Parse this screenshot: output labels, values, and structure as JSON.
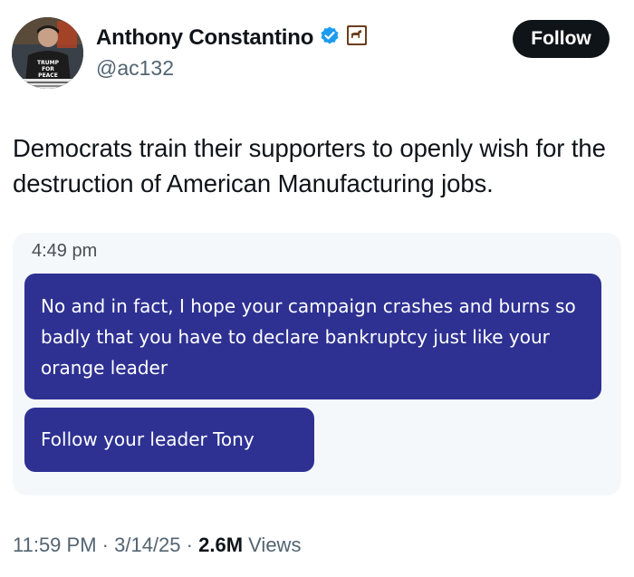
{
  "author": {
    "display_name": "Anthony Constantino",
    "handle": "@ac132",
    "avatar_shirt_text": "TRUMP FOR PEACE",
    "verified_icon": "verified-badge-icon",
    "affiliate_icon": "affiliate-badge-icon",
    "colors": {
      "verified": "#1d9bf0",
      "affiliate": "#6b3e1f"
    }
  },
  "follow_button": {
    "label": "Follow"
  },
  "tweet": {
    "text": "Democrats train their supporters to openly wish for the destruction of American Manufacturing jobs."
  },
  "media": {
    "timestamp": "4:49 pm",
    "messages": [
      {
        "text": "No and in fact, I hope your campaign crashes and burns so badly that you have to declare bankruptcy just like your orange leader"
      },
      {
        "text": "Follow your leader Tony"
      }
    ],
    "colors": {
      "bubble": "#2e3192",
      "background": "#f5f8fa"
    }
  },
  "footer": {
    "time": "11:59 PM",
    "separator": "·",
    "date": "3/14/25",
    "views_count": "2.6M",
    "views_label": "Views"
  }
}
